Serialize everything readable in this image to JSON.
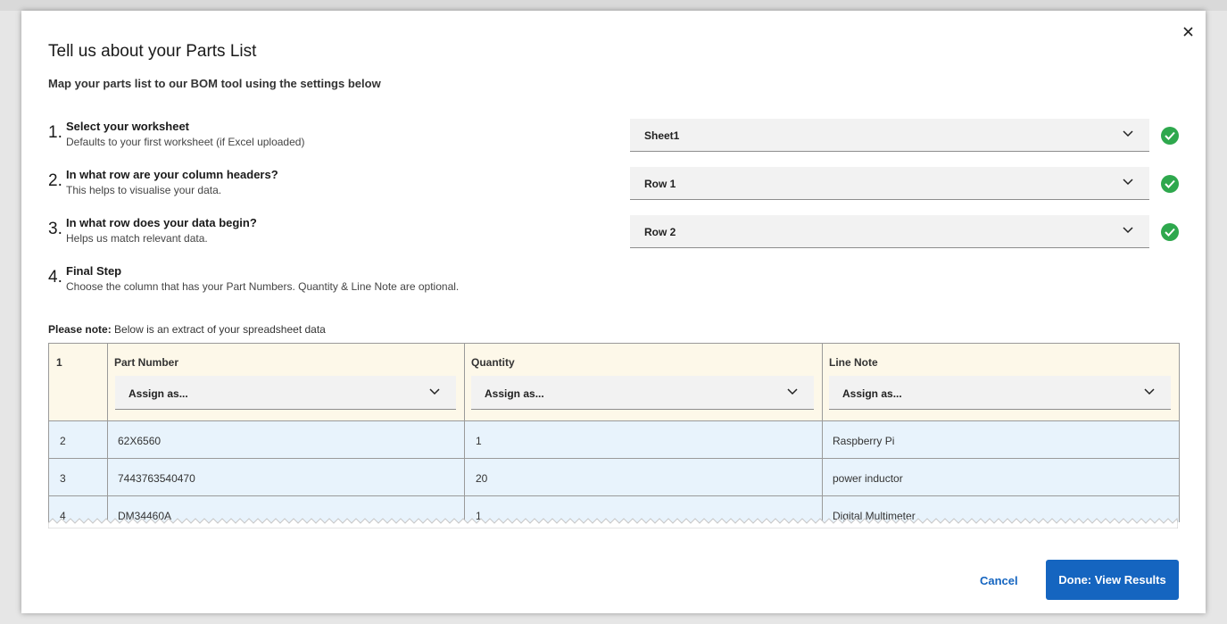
{
  "dialog": {
    "title": "Tell us about your Parts List",
    "subtitle": "Map your parts list to our BOM tool using the settings below",
    "close_icon": "close-icon"
  },
  "steps": [
    {
      "number": "1.",
      "title": "Select your worksheet",
      "description": "Defaults to your first worksheet (if Excel uploaded)",
      "select_value": "Sheet1",
      "status": "complete"
    },
    {
      "number": "2.",
      "title": "In what row are your column headers?",
      "description": "This helps to visualise your data.",
      "select_value": "Row 1",
      "status": "complete"
    },
    {
      "number": "3.",
      "title": "In what row does your data begin?",
      "description": "Helps us match relevant data.",
      "select_value": "Row 2",
      "status": "complete"
    },
    {
      "number": "4.",
      "title": "Final Step",
      "description": "Choose the column that has your Part Numbers. Quantity & Line Note are optional."
    }
  ],
  "note": {
    "label": "Please note:",
    "text": "Below is an extract of your spreadsheet data"
  },
  "table": {
    "header_row_number": "1",
    "columns": [
      {
        "label": "Part Number",
        "assign": "Assign as..."
      },
      {
        "label": "Quantity",
        "assign": "Assign as..."
      },
      {
        "label": "Line Note",
        "assign": "Assign as..."
      }
    ],
    "rows": [
      {
        "row": "2",
        "cells": [
          "62X6560",
          "1",
          "Raspberry Pi"
        ]
      },
      {
        "row": "3",
        "cells": [
          "7443763540470",
          "20",
          "power inductor"
        ]
      },
      {
        "row": "4",
        "cells": [
          "DM34460A",
          "1",
          "Digital Multimeter"
        ]
      }
    ]
  },
  "footer": {
    "cancel_label": "Cancel",
    "done_label": "Done: View Results"
  },
  "colors": {
    "accent": "#1565c0",
    "success": "#2ea84d",
    "header_bg": "#fdf8e9",
    "row_bg": "#e8f3fc"
  }
}
